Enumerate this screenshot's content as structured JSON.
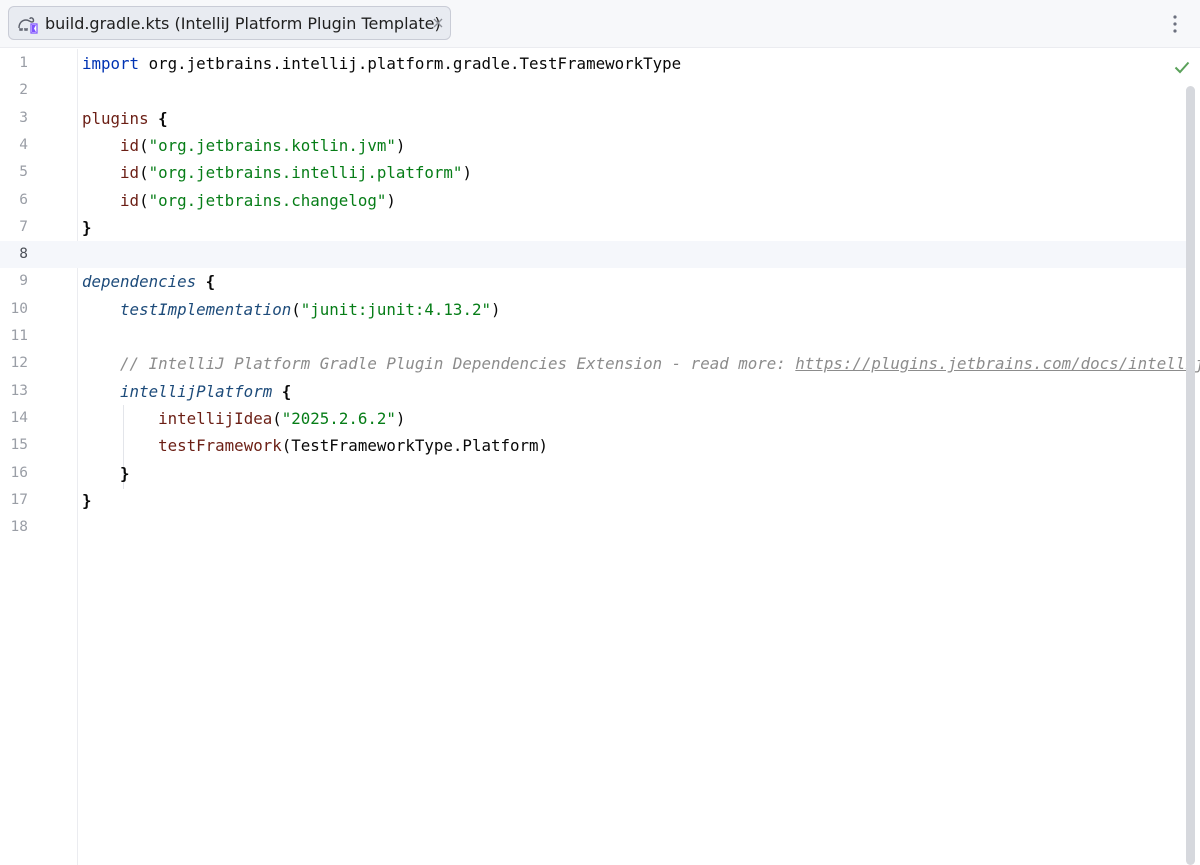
{
  "tab": {
    "title": "build.gradle.kts (IntelliJ Platform Plugin Template)",
    "icon": "gradle-kotlin-file-icon",
    "close_icon": "close-icon"
  },
  "toolbar": {
    "more_icon": "more-vertical-icon"
  },
  "inspection": {
    "status_icon": "checkmark-icon",
    "status_color": "#5aa15a"
  },
  "editor": {
    "current_line": 8,
    "lines": [
      {
        "n": "1",
        "tokens": [
          {
            "c": "kw",
            "t": "import"
          },
          {
            "c": "plain",
            "t": " org.jetbrains.intellij.platform.gradle.TestFrameworkType"
          }
        ]
      },
      {
        "n": "2",
        "tokens": []
      },
      {
        "n": "3",
        "tokens": [
          {
            "c": "call",
            "t": "plugins"
          },
          {
            "c": "plain",
            "t": " "
          },
          {
            "c": "brace",
            "t": "{"
          }
        ]
      },
      {
        "n": "4",
        "tokens": [
          {
            "c": "plain",
            "t": "    "
          },
          {
            "c": "call",
            "t": "id"
          },
          {
            "c": "plain",
            "t": "("
          },
          {
            "c": "str",
            "t": "\"org.jetbrains.kotlin.jvm\""
          },
          {
            "c": "plain",
            "t": ")"
          }
        ]
      },
      {
        "n": "5",
        "tokens": [
          {
            "c": "plain",
            "t": "    "
          },
          {
            "c": "call",
            "t": "id"
          },
          {
            "c": "plain",
            "t": "("
          },
          {
            "c": "str",
            "t": "\"org.jetbrains.intellij.platform\""
          },
          {
            "c": "plain",
            "t": ")"
          }
        ]
      },
      {
        "n": "6",
        "tokens": [
          {
            "c": "plain",
            "t": "    "
          },
          {
            "c": "call",
            "t": "id"
          },
          {
            "c": "plain",
            "t": "("
          },
          {
            "c": "str",
            "t": "\"org.jetbrains.changelog\""
          },
          {
            "c": "plain",
            "t": ")"
          }
        ]
      },
      {
        "n": "7",
        "tokens": [
          {
            "c": "brace",
            "t": "}"
          }
        ]
      },
      {
        "n": "8",
        "tokens": []
      },
      {
        "n": "9",
        "tokens": [
          {
            "c": "ext",
            "t": "dependencies"
          },
          {
            "c": "plain",
            "t": " "
          },
          {
            "c": "brace",
            "t": "{"
          }
        ]
      },
      {
        "n": "10",
        "tokens": [
          {
            "c": "plain",
            "t": "    "
          },
          {
            "c": "ext",
            "t": "testImplementation"
          },
          {
            "c": "plain",
            "t": "("
          },
          {
            "c": "str",
            "t": "\"junit:junit:4.13.2\""
          },
          {
            "c": "plain",
            "t": ")"
          }
        ]
      },
      {
        "n": "11",
        "tokens": []
      },
      {
        "n": "12",
        "tokens": [
          {
            "c": "plain",
            "t": "    "
          },
          {
            "c": "comment",
            "t": "// IntelliJ Platform Gradle Plugin Dependencies Extension - read more: "
          },
          {
            "c": "link",
            "t": "https://plugins.jetbrains.com/docs/intellij/tools-intellij-platform-gradle-plugin-dependencies-extension.html"
          }
        ]
      },
      {
        "n": "13",
        "tokens": [
          {
            "c": "plain",
            "t": "    "
          },
          {
            "c": "ext",
            "t": "intellijPlatform"
          },
          {
            "c": "plain",
            "t": " "
          },
          {
            "c": "brace",
            "t": "{"
          }
        ]
      },
      {
        "n": "14",
        "tokens": [
          {
            "c": "plain",
            "t": "        "
          },
          {
            "c": "call",
            "t": "intellijIdea"
          },
          {
            "c": "plain",
            "t": "("
          },
          {
            "c": "str",
            "t": "\"2025.2.6.2\""
          },
          {
            "c": "plain",
            "t": ")"
          }
        ]
      },
      {
        "n": "15",
        "tokens": [
          {
            "c": "plain",
            "t": "        "
          },
          {
            "c": "call",
            "t": "testFramework"
          },
          {
            "c": "plain",
            "t": "(TestFrameworkType.Platform)"
          }
        ]
      },
      {
        "n": "16",
        "tokens": [
          {
            "c": "plain",
            "t": "    "
          },
          {
            "c": "brace",
            "t": "}"
          }
        ]
      },
      {
        "n": "17",
        "tokens": [
          {
            "c": "brace",
            "t": "}"
          }
        ]
      },
      {
        "n": "18",
        "tokens": []
      }
    ]
  }
}
